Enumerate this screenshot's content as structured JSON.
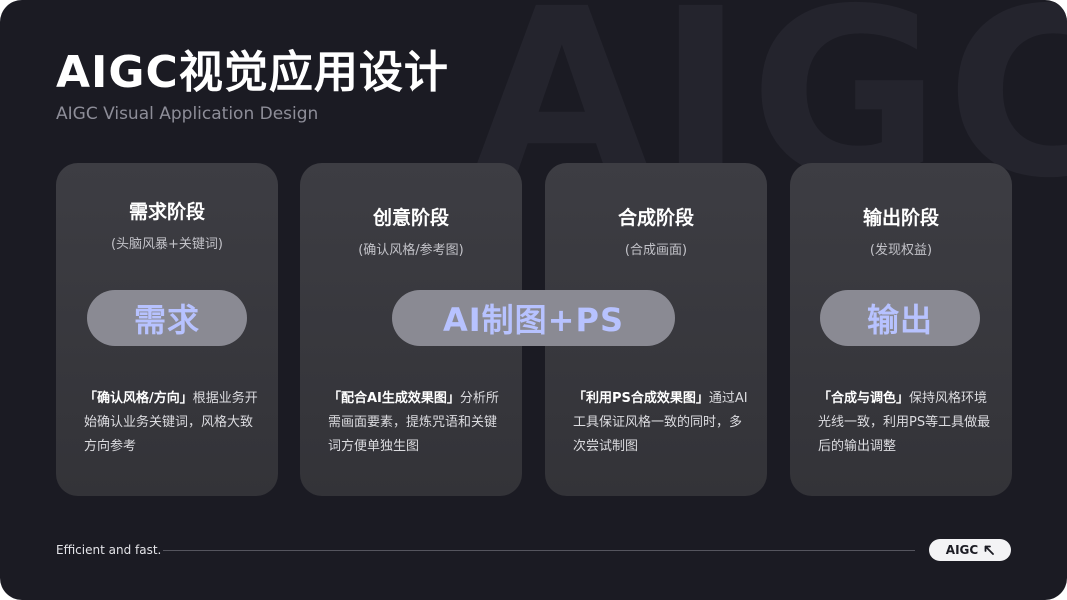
{
  "background_word": "AIGC",
  "title": "AIGC视觉应用设计",
  "subtitle": "AIGC Visual Application Design",
  "cards": [
    {
      "title": "需求阶段",
      "subtitle": "(头脑风暴+关键词)",
      "desc_bold": "「确认风格/方向」",
      "desc_rest": "根据业务开始确认业务关键词，风格大致方向参考"
    },
    {
      "title": "创意阶段",
      "subtitle": "(确认风格/参考图)",
      "desc_bold": "「配合AI生成效果图」",
      "desc_rest": "分析所需画面要素，提炼咒语和关键词方便单独生图"
    },
    {
      "title": "合成阶段",
      "subtitle": "(合成画面)",
      "desc_bold": "「利用PS合成效果图」",
      "desc_rest": "通过AI工具保证风格一致的同时，多次尝试制图"
    },
    {
      "title": "输出阶段",
      "subtitle": "(发现权益)",
      "desc_bold": "「合成与调色」",
      "desc_rest": "保持风格环境光线一致，利用PS等工具做最后的输出调整"
    }
  ],
  "pills": [
    "需求",
    "AI制图+PS",
    "输出"
  ],
  "footer": {
    "tagline": "Efficient and fast.",
    "tag_label": "AIGC",
    "tag_icon": "arrow-up-left-icon"
  },
  "colors": {
    "background": "#1b1b23",
    "card": "#38383e",
    "pill": "#8a8a93",
    "pill_text": "#b7c2ff"
  }
}
